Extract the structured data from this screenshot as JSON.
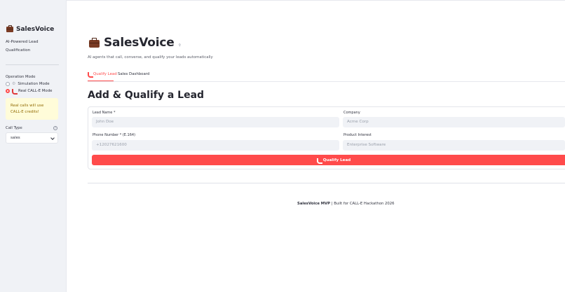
{
  "sidebar": {
    "brand": "SalesVoice",
    "subtitle": "AI-Powered Lead Qualification",
    "mode_label": "Operation Mode",
    "modes": [
      {
        "label": "Simulation Mode",
        "selected": false
      },
      {
        "label": "Real CALL-E Mode",
        "selected": true
      }
    ],
    "warning": "Real calls will use CALL-E credits!",
    "call_type_label": "Call Type",
    "call_type_value": "sales"
  },
  "header": {
    "title": "SalesVoice",
    "tagline": "AI agents that call, converse, and qualify your leads automatically"
  },
  "tabs": [
    {
      "label": "Qualify Lead",
      "active": true
    },
    {
      "label": "Sales Dashboard",
      "active": false
    }
  ],
  "form": {
    "heading": "Add & Qualify a Lead",
    "lead_name_label": "Lead Name *",
    "lead_name_placeholder": "John Doe",
    "company_label": "Company",
    "company_placeholder": "Acme Corp",
    "phone_label": "Phone Number * (E.164)",
    "phone_placeholder": "+12027621600",
    "interest_label": "Product Interest",
    "interest_placeholder": "Enterprise Software",
    "submit_label": "Qualify Lead"
  },
  "footer": {
    "brand": "SalesVoice MVP",
    "text": " | Built for CALL-E Hackathon 2026"
  },
  "colors": {
    "accent": "#ff4b4b",
    "sidebar_bg": "#f0f2f6",
    "warning_bg": "#fffcd9",
    "warning_text": "#926c05"
  }
}
